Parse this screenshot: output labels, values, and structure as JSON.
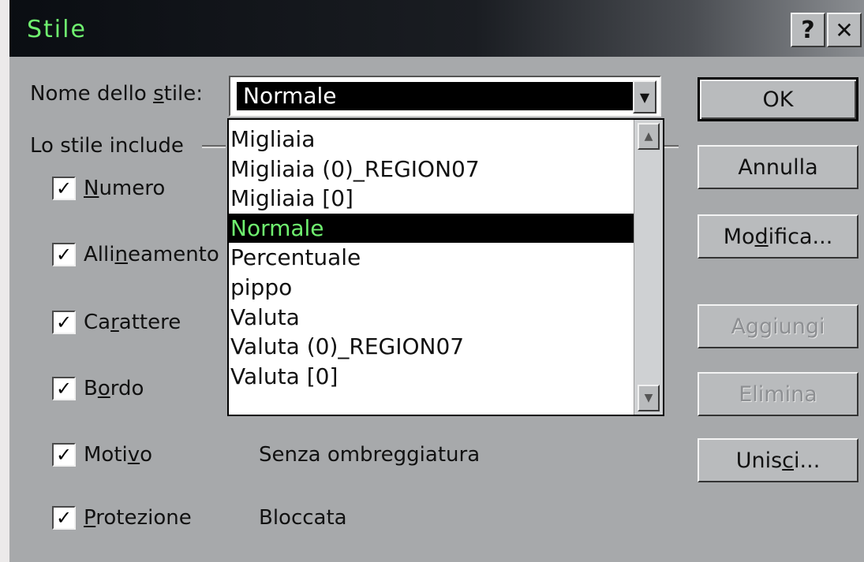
{
  "window": {
    "title": "Stile",
    "help_label": "?",
    "close_label": "✕"
  },
  "style_name": {
    "label_pre": "Nome dello ",
    "label_u": "s",
    "label_post": "tile:",
    "value": "Normale"
  },
  "dropdown": {
    "items": [
      "Migliaia",
      "Migliaia (0)_REGION07",
      "Migliaia [0]",
      "Normale",
      "Percentuale",
      "pippo",
      "Valuta",
      "Valuta (0)_REGION07",
      "Valuta [0]"
    ],
    "selected_index": 3
  },
  "group": {
    "label": "Lo stile include"
  },
  "checkboxes": [
    {
      "pre": "",
      "u": "N",
      "post": "umero",
      "checked": true,
      "description": ""
    },
    {
      "pre": "Alli",
      "u": "n",
      "post": "eamento",
      "checked": true,
      "description": ""
    },
    {
      "pre": "Ca",
      "u": "r",
      "post": "attere",
      "checked": true,
      "description": ""
    },
    {
      "pre": "B",
      "u": "o",
      "post": "rdo",
      "checked": true,
      "description": ""
    },
    {
      "pre": "Moti",
      "u": "v",
      "post": "o",
      "checked": true,
      "description": "Senza ombreggiatura"
    },
    {
      "pre": "",
      "u": "P",
      "post": "rotezione",
      "checked": true,
      "description": "Bloccata"
    }
  ],
  "check_mark": "✓",
  "buttons": {
    "ok": "OK",
    "annulla": "Annulla",
    "modifica_pre": "Mo",
    "modifica_u": "d",
    "modifica_post": "ifica...",
    "aggiungi": "Aggiungi",
    "elimina": "Elimina",
    "unisci_pre": "Unis",
    "unisci_u": "c",
    "unisci_post": "i..."
  },
  "colors": {
    "title_text": "#6ff06f",
    "selected_text": "#6ff06f",
    "dialog_bg": "#a7a9ab"
  }
}
